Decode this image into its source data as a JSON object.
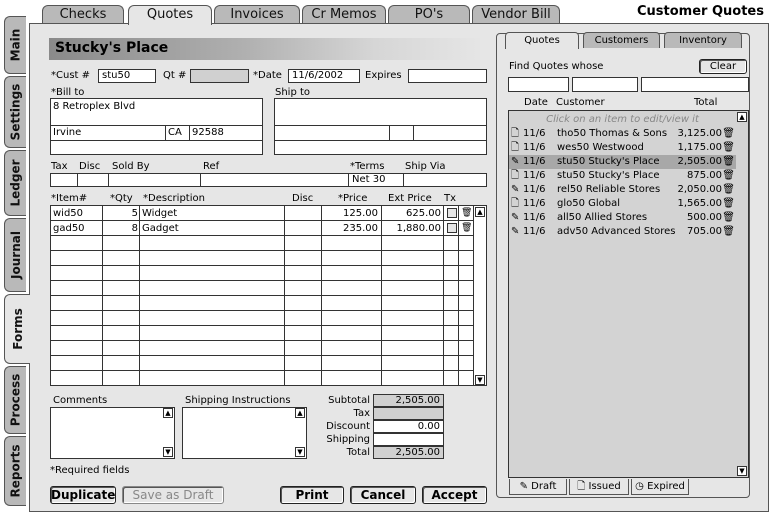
{
  "app_title": "Customer Quotes",
  "top_tabs": [
    {
      "label": "Checks"
    },
    {
      "label": "Quotes",
      "active": true
    },
    {
      "label": "Invoices"
    },
    {
      "label": "Cr Memos"
    },
    {
      "label": "PO's"
    },
    {
      "label": "Vendor Bill"
    }
  ],
  "side_tabs": [
    {
      "label": "Main"
    },
    {
      "label": "Settings"
    },
    {
      "label": "Ledger"
    },
    {
      "label": "Journal"
    },
    {
      "label": "Forms",
      "active": true
    },
    {
      "label": "Process"
    },
    {
      "label": "Reports"
    }
  ],
  "form": {
    "title": "Stucky's Place",
    "cust_label": "*Cust #",
    "cust_value": "stu50",
    "qt_label": "Qt #",
    "qt_value": "",
    "date_label": "*Date",
    "date_value": "11/6/2002",
    "expires_label": "Expires",
    "expires_value": "",
    "bill_to_label": "*Bill to",
    "bill_to": {
      "line1": "8 Retroplex Blvd",
      "city": "Irvine",
      "state": "CA",
      "zip": "92588"
    },
    "ship_to_label": "Ship to",
    "tax_label": "Tax",
    "disc_label": "Disc",
    "sold_by_label": "Sold By",
    "ref_label": "Ref",
    "terms_label": "*Terms",
    "terms_value": "Net 30",
    "ship_via_label": "Ship Via",
    "items_header": {
      "item": "*Item#",
      "qty": "*Qty",
      "desc": "*Description",
      "disc": "Disc",
      "price": "*Price",
      "ext": "Ext Price",
      "tx": "Tx"
    },
    "items": [
      {
        "item": "wid50",
        "qty": "5",
        "desc": "Widget",
        "disc": "",
        "price": "125.00",
        "ext": "625.00"
      },
      {
        "item": "gad50",
        "qty": "8",
        "desc": "Gadget",
        "disc": "",
        "price": "235.00",
        "ext": "1,880.00"
      }
    ],
    "comments_label": "Comments",
    "shipping_instructions_label": "Shipping Instructions",
    "totals": {
      "subtotal_label": "Subtotal",
      "subtotal": "2,505.00",
      "tax_label": "Tax",
      "tax": "",
      "discount_label": "Discount",
      "discount": "0.00",
      "shipping_label": "Shipping",
      "shipping": "",
      "total_label": "Total",
      "total": "2,505.00"
    },
    "required_note": "*Required fields",
    "buttons": {
      "duplicate": "Duplicate",
      "save_draft": "Save as Draft",
      "print": "Print",
      "cancel": "Cancel",
      "accept": "Accept"
    }
  },
  "right_panel": {
    "tabs": [
      {
        "label": "Quotes",
        "active": true
      },
      {
        "label": "Customers"
      },
      {
        "label": "Inventory"
      }
    ],
    "find_label": "Find Quotes whose",
    "clear_label": "Clear",
    "columns": {
      "date": "Date",
      "customer": "Customer",
      "total": "Total"
    },
    "hint": "Click on an item to edit/view it",
    "rows": [
      {
        "icon": "document-icon",
        "date": "11/6",
        "customer": "tho50 Thomas & Sons",
        "total": "3,125.00"
      },
      {
        "icon": "document-icon",
        "date": "11/6",
        "customer": "wes50 Westwood",
        "total": "1,175.00"
      },
      {
        "icon": "pencil-icon",
        "date": "11/6",
        "customer": "stu50 Stucky's Place",
        "total": "2,505.00",
        "selected": true
      },
      {
        "icon": "document-icon",
        "date": "11/6",
        "customer": "stu50 Stucky's Place",
        "total": "875.00"
      },
      {
        "icon": "pencil-icon",
        "date": "11/6",
        "customer": "rel50 Reliable Stores",
        "total": "2,050.00"
      },
      {
        "icon": "document-icon",
        "date": "11/6",
        "customer": "glo50 Global",
        "total": "1,565.00"
      },
      {
        "icon": "pencil-icon",
        "date": "11/6",
        "customer": "all50 Allied Stores",
        "total": "500.00"
      },
      {
        "icon": "pencil-icon",
        "date": "11/6",
        "customer": "adv50 Advanced Stores",
        "total": "705.00"
      }
    ],
    "bottom_tabs": [
      {
        "icon": "pencil-icon",
        "label": "Draft",
        "active": true
      },
      {
        "icon": "document-icon",
        "label": "Issued"
      },
      {
        "icon": "clock-icon",
        "label": "Expired"
      }
    ]
  }
}
